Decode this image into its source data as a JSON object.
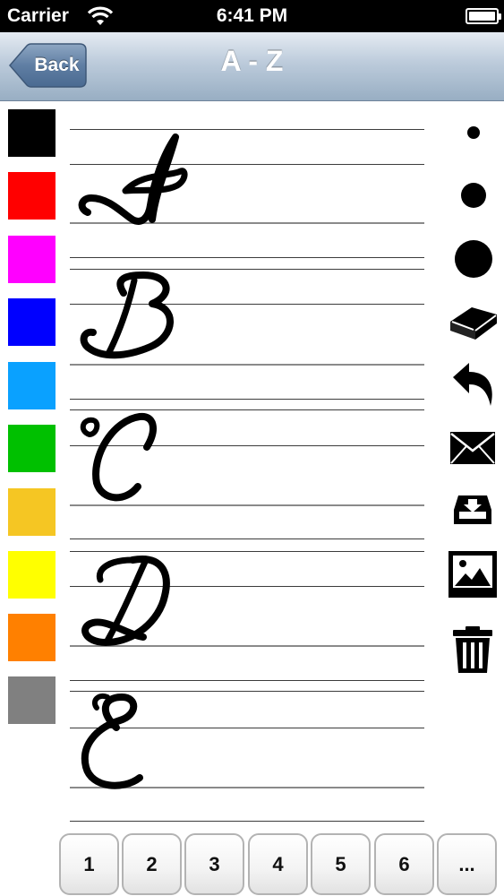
{
  "status_bar": {
    "carrier": "Carrier",
    "time": "6:41 PM",
    "wifi_icon": "wifi-icon",
    "battery_icon": "battery-icon"
  },
  "nav": {
    "back_label": "Back",
    "title": "A - Z"
  },
  "palette": [
    {
      "name": "black",
      "color": "#000000"
    },
    {
      "name": "red",
      "color": "#ff0000"
    },
    {
      "name": "magenta",
      "color": "#ff00ff"
    },
    {
      "name": "blue",
      "color": "#0000ff"
    },
    {
      "name": "sky-blue",
      "color": "#0aa1ff"
    },
    {
      "name": "green",
      "color": "#00c000"
    },
    {
      "name": "gold",
      "color": "#f5c623"
    },
    {
      "name": "yellow",
      "color": "#ffff00"
    },
    {
      "name": "orange",
      "color": "#ff8000"
    },
    {
      "name": "gray",
      "color": "#808080"
    }
  ],
  "letters": [
    "A",
    "B",
    "C",
    "D",
    "E"
  ],
  "tools": [
    "small-brush-icon",
    "medium-brush-icon",
    "large-brush-icon",
    "eraser-icon",
    "undo-icon",
    "mail-icon",
    "save-icon",
    "image-icon",
    "trash-icon"
  ],
  "pages": [
    "1",
    "2",
    "3",
    "4",
    "5",
    "6",
    "..."
  ]
}
